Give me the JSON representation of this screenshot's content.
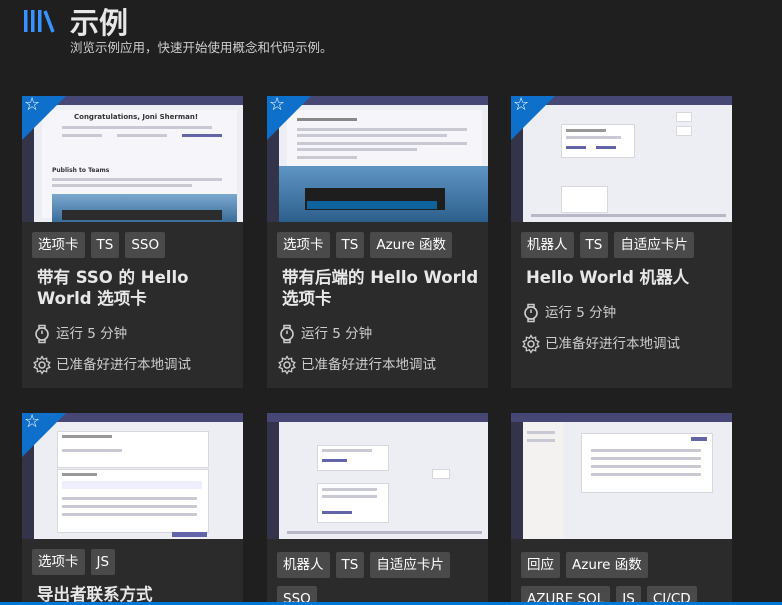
{
  "header": {
    "title": "示例",
    "subtitle": "浏览示例应用，快速开始使用概念和代码示例。"
  },
  "cards": [
    {
      "tags": [
        "选项卡",
        "TS",
        "SSO"
      ],
      "title": "带有 SSO 的 Hello World 选项卡",
      "run_time": "运行 5 分钟",
      "debug": "已准备好进行本地调试",
      "featured": true
    },
    {
      "tags": [
        "选项卡",
        "TS",
        "Azure 函数"
      ],
      "title": "带有后端的 Hello World 选项卡",
      "run_time": "运行 5 分钟",
      "debug": "已准备好进行本地调试",
      "featured": true
    },
    {
      "tags": [
        "机器人",
        "TS",
        "自适应卡片"
      ],
      "title": "Hello World 机器人",
      "run_time": "运行 5 分钟",
      "debug": "已准备好进行本地调试",
      "featured": true
    },
    {
      "tags": [
        "选项卡",
        "JS"
      ],
      "title": "导出者联系方式",
      "featured": true
    },
    {
      "tags": [
        "机器人",
        "TS",
        "自适应卡片",
        "SSO"
      ],
      "featured": false
    },
    {
      "tags": [
        "回应",
        "Azure 函数",
        "AZURE SQL",
        "JS",
        "CI/CD"
      ],
      "featured": false
    }
  ],
  "thumbs": {
    "card1_heading": "Congratulations, Joni Sherman!",
    "card1_section": "Publish to Teams"
  },
  "colors": {
    "background": "#1f1f1f",
    "card": "#2b2b2b",
    "tag": "#4a4a4a",
    "badge": "#0f70cc",
    "accent": "#0078d4"
  },
  "icons": {
    "logo": "library-icon",
    "featured": "star-icon",
    "run_time": "stopwatch-icon",
    "debug": "gear-icon"
  }
}
